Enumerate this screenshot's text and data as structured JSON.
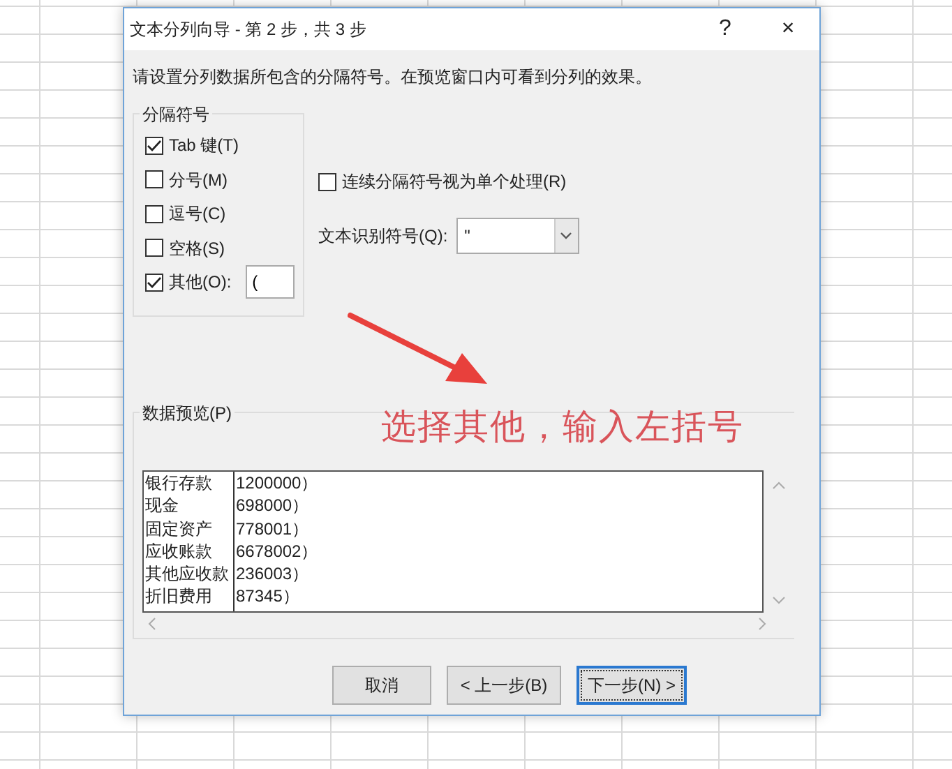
{
  "window": {
    "title": "文本分列向导 - 第 2 步，共 3 步",
    "help": "?",
    "close": "×"
  },
  "instruction": "请设置分列数据所包含的分隔符号。在预览窗口内可看到分列的效果。",
  "delimiters": {
    "title": "分隔符号",
    "items": [
      {
        "label": "Tab 键(T)",
        "checked": true
      },
      {
        "label": "分号(M)",
        "checked": false
      },
      {
        "label": "逗号(C)",
        "checked": false
      },
      {
        "label": "空格(S)",
        "checked": false
      },
      {
        "label": "其他(O):",
        "checked": true,
        "value": "("
      }
    ]
  },
  "consecutive": {
    "label": "连续分隔符号视为单个处理(R)",
    "checked": false
  },
  "text_qualifier": {
    "label": "文本识别符号(Q):",
    "value": "\""
  },
  "preview": {
    "title": "数据预览(P)",
    "rows": [
      [
        "银行存款",
        "1200000）"
      ],
      [
        "现金",
        "698000）"
      ],
      [
        "固定资产",
        "778001）"
      ],
      [
        "应收账款",
        "6678002）"
      ],
      [
        "其他应收款",
        "236003）"
      ],
      [
        "折旧费用",
        "87345）"
      ]
    ]
  },
  "annotation": "选择其他，输入左括号",
  "buttons": [
    {
      "label": "取消",
      "focused": false
    },
    {
      "label": "< 上一步(B)",
      "focused": false
    },
    {
      "label": "下一步(N) >",
      "focused": true
    }
  ]
}
